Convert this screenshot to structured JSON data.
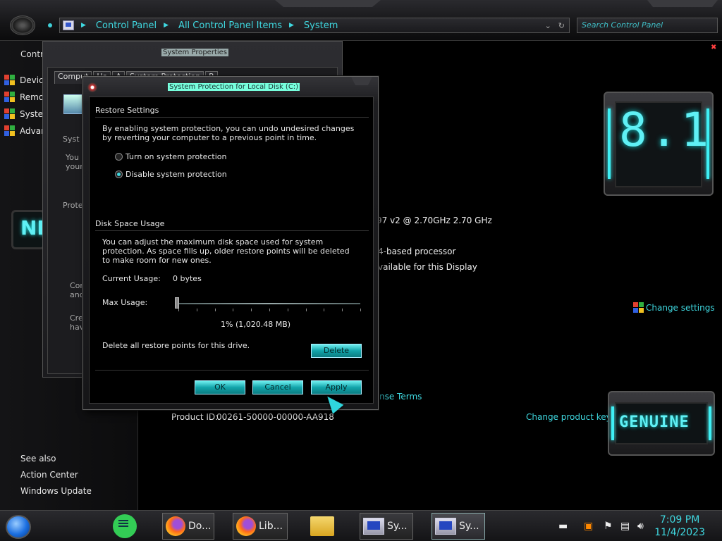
{
  "address": {
    "crumbs": [
      "Control Panel",
      "All Control Panel Items",
      "System"
    ],
    "search_placeholder": "Search Control Panel"
  },
  "left_pane": {
    "title": "Contr",
    "items": [
      "Devic",
      "Remo",
      "Syster",
      "Advan"
    ],
    "see_also": "See also",
    "links": [
      "Action Center",
      "Windows Update"
    ],
    "emblem_text": "NL"
  },
  "main": {
    "processor_speed": "97 v2 @ 2.70GHz   2.70 GHz",
    "system_type": "4-based processor",
    "pen_touch": "vailable for this Display",
    "change_settings": "Change settings",
    "license_terms": "nse Terms",
    "product_id_label": "Product ID:",
    "product_id": "00261-50000-00000-AA918",
    "change_product_key": "Change product key",
    "version_badge": "8.1",
    "genuine_badge": "GENUINE"
  },
  "system_properties": {
    "title": "System Properties",
    "tabs": [
      "Comput",
      "Ha",
      "A",
      "System Protection",
      "R"
    ],
    "fragments": [
      "Syst",
      "You",
      "your",
      "Prote",
      "Con",
      "and",
      "Cre",
      "hav"
    ]
  },
  "dialog": {
    "title": "System Protection for Local Disk (C:)",
    "restore_heading": "Restore Settings",
    "restore_text": "By enabling system protection, you can undo undesired changes by reverting your computer to a previous point in time.",
    "radio_on": "Turn on system protection",
    "radio_off": "Disable system protection",
    "disk_heading": "Disk Space Usage",
    "disk_text": "You can adjust the maximum disk space used for system protection. As space fills up, older restore points will be deleted to make room for new ones.",
    "current_usage_label": "Current Usage:",
    "current_usage_value": "0 bytes",
    "max_usage_label": "Max Usage:",
    "max_usage_value": "1% (1,020.48 MB)",
    "max_usage_fraction": 0.01,
    "delete_text": "Delete all restore points for this drive.",
    "delete_button": "Delete",
    "ok_button": "OK",
    "cancel_button": "Cancel",
    "apply_button": "Apply"
  },
  "taskbar": {
    "tasks": [
      "Do...",
      "Lib...",
      "Sy...",
      "Sy..."
    ],
    "time": "7:09 PM",
    "date": "11/4/2023"
  }
}
